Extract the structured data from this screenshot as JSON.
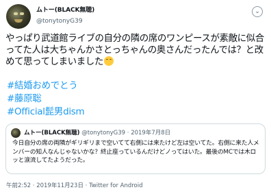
{
  "tweet": {
    "display_name": "ムトー(BLACK無聴)",
    "handle": "@tonytonyG39",
    "text": "やっぱり武道館ライブの自分の隣の席のワンピースが素敵に似合ってた人は大ちゃんかさとっちゃんの奥さんだったんでは？と改めて思ってしまいました",
    "emoji": "smiling-face-emoji",
    "hashtags": [
      "#結婚おめでとう",
      "#藤原聡",
      "#Official髭男dism"
    ],
    "timestamp": "午前2:52 · 2019年11月23日 · Twitter for Android"
  },
  "quoted": {
    "display_name": "ムトー(BLACK無聴)",
    "handle": "@tonytonyG39",
    "date": "· 2019年7月8日",
    "text": "今日自分の席の両隣がギリギリまで空いてて右側には来たけど左は空いてた。右側に来た人メンバーの知人なんじゃないかな？終止座っているんだけどノってはいた。最後のMCでは木ロッと涙流してたようだった。"
  },
  "colors": {
    "text": "#0f1419",
    "secondary": "#536471",
    "link": "#1d9bf0",
    "border": "#cfd9de"
  },
  "icons": {
    "more": "chevron-down-icon"
  }
}
